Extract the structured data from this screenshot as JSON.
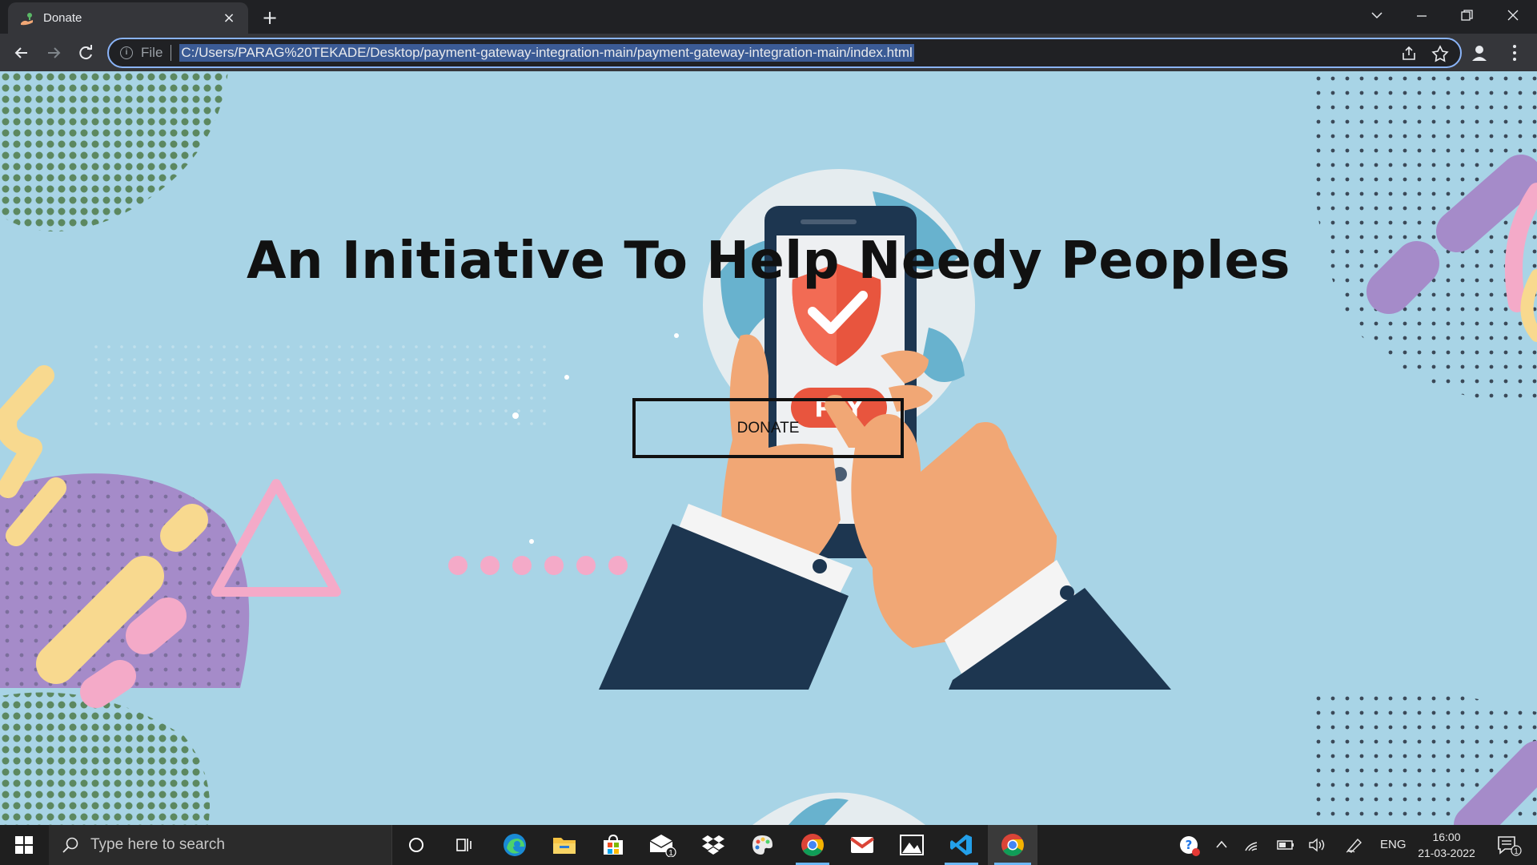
{
  "browser": {
    "tab_title": "Donate",
    "tab_close_glyph": "×",
    "new_tab_glyph": "+",
    "url_scheme_label": "File",
    "url": "C:/Users/PARAG%20TEKADE/Desktop/payment-gateway-integration-main/payment-gateway-integration-main/index.html",
    "icons": [
      "tab-favicon-icon",
      "back-icon",
      "forward-icon",
      "reload-icon",
      "info-icon",
      "share-icon",
      "bookmark-star-icon",
      "profile-icon",
      "menu-icon",
      "tab-search-icon",
      "minimize-icon",
      "restore-icon",
      "close-icon"
    ]
  },
  "page": {
    "headline": "An Initiative To Help Needy Peoples",
    "donate_label": "DONATE",
    "hero_button_text": "PAY",
    "colors": {
      "background": "#a8d4e6",
      "shield": "#e8553e",
      "sleeve": "#1d3650",
      "skin": "#f1a775",
      "pink": "#f4aac8",
      "purple": "#a58bc9",
      "yellow": "#f8d98f"
    }
  },
  "taskbar": {
    "search_placeholder": "Type here to search",
    "language": "ENG",
    "time": "16:00",
    "date": "21-03-2022",
    "mail_badge": "1",
    "notification_badge": "1",
    "apps": [
      "start-icon",
      "cortana-icon",
      "task-view-icon",
      "edge-icon",
      "file-explorer-icon",
      "store-icon",
      "mail-icon",
      "dropbox-icon",
      "paint-icon",
      "chrome-icon",
      "gmail-icon",
      "photos-icon",
      "vscode-icon",
      "chrome-active-icon"
    ]
  }
}
